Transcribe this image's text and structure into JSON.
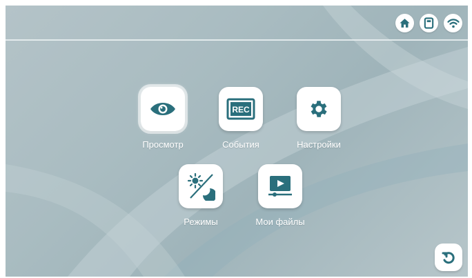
{
  "theme": {
    "accent": "#2a6f7c",
    "tile_bg": "#ffffff",
    "label_color": "#ffffff"
  },
  "status_bar": {
    "icons": [
      "home-icon",
      "sd-card-icon",
      "wifi-icon"
    ]
  },
  "menu": {
    "items": [
      {
        "id": "view",
        "label": "Просмотр",
        "icon": "eye-icon",
        "selected": true
      },
      {
        "id": "events",
        "label": "События",
        "icon": "rec-icon",
        "selected": false
      },
      {
        "id": "settings",
        "label": "Настройки",
        "icon": "gear-icon",
        "selected": false
      },
      {
        "id": "modes",
        "label": "Режимы",
        "icon": "day-night-icon",
        "selected": false
      },
      {
        "id": "my_files",
        "label": "Мои файлы",
        "icon": "video-file-icon",
        "selected": false
      }
    ]
  },
  "events_icon_text": "REC",
  "back_button": {
    "icon": "back-arrow-icon"
  }
}
